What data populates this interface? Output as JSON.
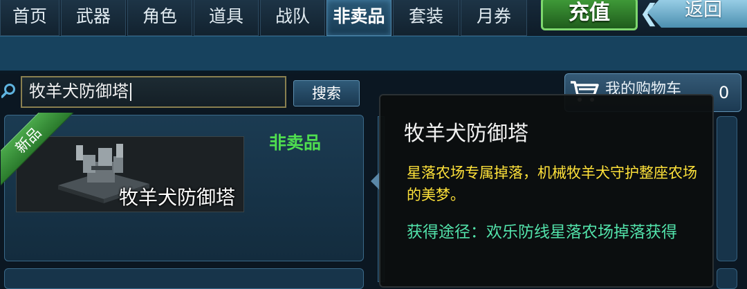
{
  "tabs": [
    {
      "label": "首页",
      "active": false
    },
    {
      "label": "武器",
      "active": false
    },
    {
      "label": "角色",
      "active": false
    },
    {
      "label": "道具",
      "active": false
    },
    {
      "label": "战队",
      "active": false
    },
    {
      "label": "非卖品",
      "active": true
    },
    {
      "label": "套装",
      "active": false
    },
    {
      "label": "月券",
      "active": false
    }
  ],
  "header": {
    "recharge_label": "充值",
    "back_label": "返回"
  },
  "search": {
    "value": "牧羊犬防御塔",
    "button_label": "搜索"
  },
  "cart": {
    "label": "我的购物车",
    "count": "0"
  },
  "item": {
    "badge": "新品",
    "name": "牧羊犬防御塔",
    "category": "非卖品"
  },
  "tooltip": {
    "title": "牧羊犬防御塔",
    "description": "星落农场专属掉落，机械牧羊犬守护整座农场的美梦。",
    "source": "获得途径：欢乐防线星落农场掉落获得"
  },
  "colors": {
    "active_tab": "#2b5a78",
    "recharge": "#3f9a38",
    "back": "#9ed3ea",
    "tag_green": "#4fde4f",
    "desc_yellow": "#ffe23a",
    "source_green": "#52e2aa"
  },
  "icons": [
    "search-icon",
    "cart-icon",
    "back-arrow-icon"
  ]
}
